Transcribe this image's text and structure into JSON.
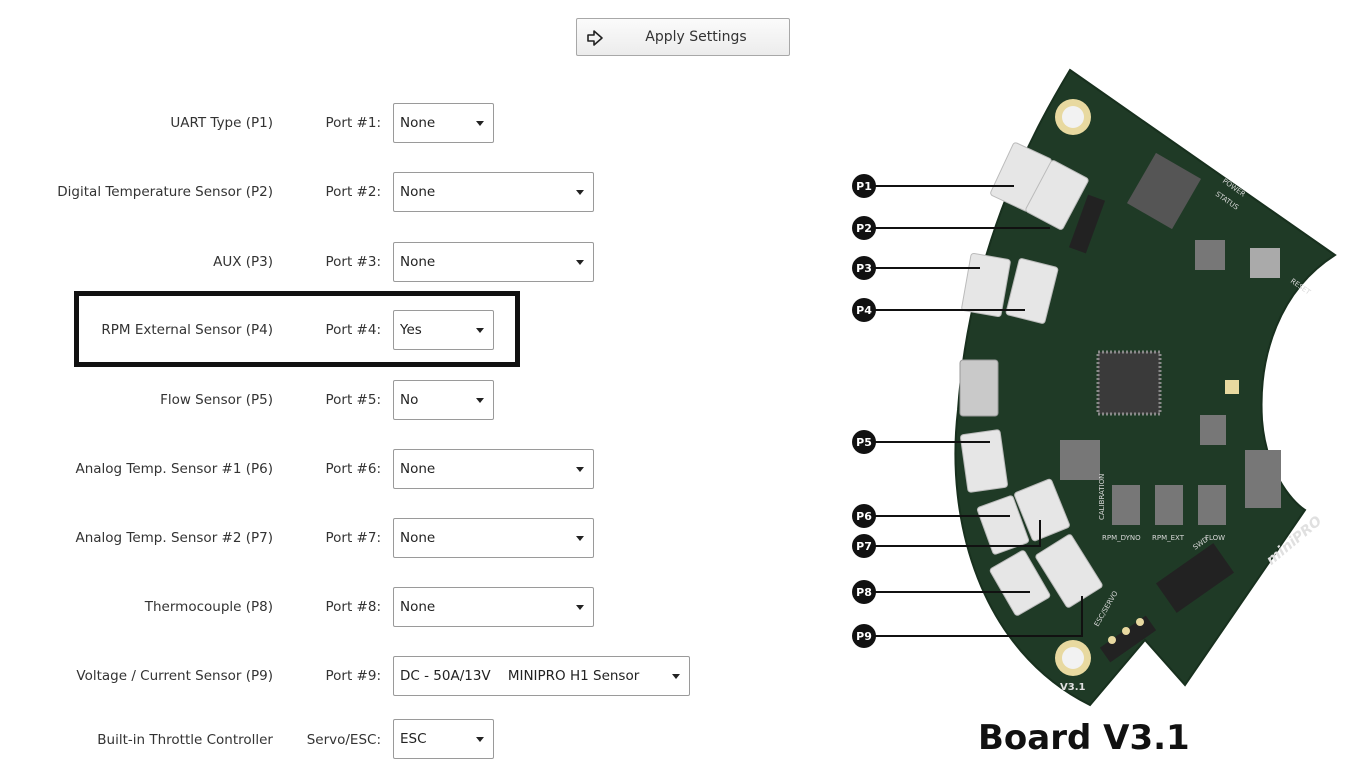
{
  "toolbar": {
    "apply_label": "Apply Settings",
    "apply_icon": "arrow-right-icon"
  },
  "rows": [
    {
      "label": "UART Type (P1)",
      "port": "Port #1:",
      "value": "None"
    },
    {
      "label": "Digital Temperature Sensor (P2)",
      "port": "Port #2:",
      "value": "None"
    },
    {
      "label": "AUX (P3)",
      "port": "Port #3:",
      "value": "None"
    },
    {
      "label": "RPM External Sensor (P4)",
      "port": "Port #4:",
      "value": "Yes"
    },
    {
      "label": "Flow Sensor (P5)",
      "port": "Port #5:",
      "value": "No"
    },
    {
      "label": "Analog Temp. Sensor #1 (P6)",
      "port": "Port #6:",
      "value": "None"
    },
    {
      "label": "Analog Temp. Sensor #2 (P7)",
      "port": "Port #7:",
      "value": "None"
    },
    {
      "label": "Thermocouple (P8)",
      "port": "Port #8:",
      "value": "None"
    },
    {
      "label": "Voltage / Current Sensor (P9)",
      "port": "Port #9:",
      "value": "DC - 50A/13V    MINIPRO H1 Sensor"
    },
    {
      "label": "Built-in Throttle Controller",
      "port": "Servo/ESC:",
      "value": "ESC"
    }
  ],
  "board": {
    "title": "Board V3.1",
    "pins": [
      "P1",
      "P2",
      "P3",
      "P4",
      "P5",
      "P6",
      "P7",
      "P8",
      "P9"
    ],
    "silk": {
      "reset": "RESET",
      "power": "POWER",
      "status": "STATUS",
      "version": "V3.1",
      "brand": "miniPRO",
      "rpm_dyno": "RPM_DYNO",
      "rpm_ext": "RPM_EXT",
      "flow": "FLOW",
      "swd": "SWD",
      "esc_servo": "ESC/SERVO",
      "calibration": "CALIBRATION"
    },
    "colors": {
      "pcb": "#1f3a26",
      "pcb_edge": "#18301e",
      "connector": "#e6e6e6",
      "pad": "#e8d9a0"
    }
  }
}
